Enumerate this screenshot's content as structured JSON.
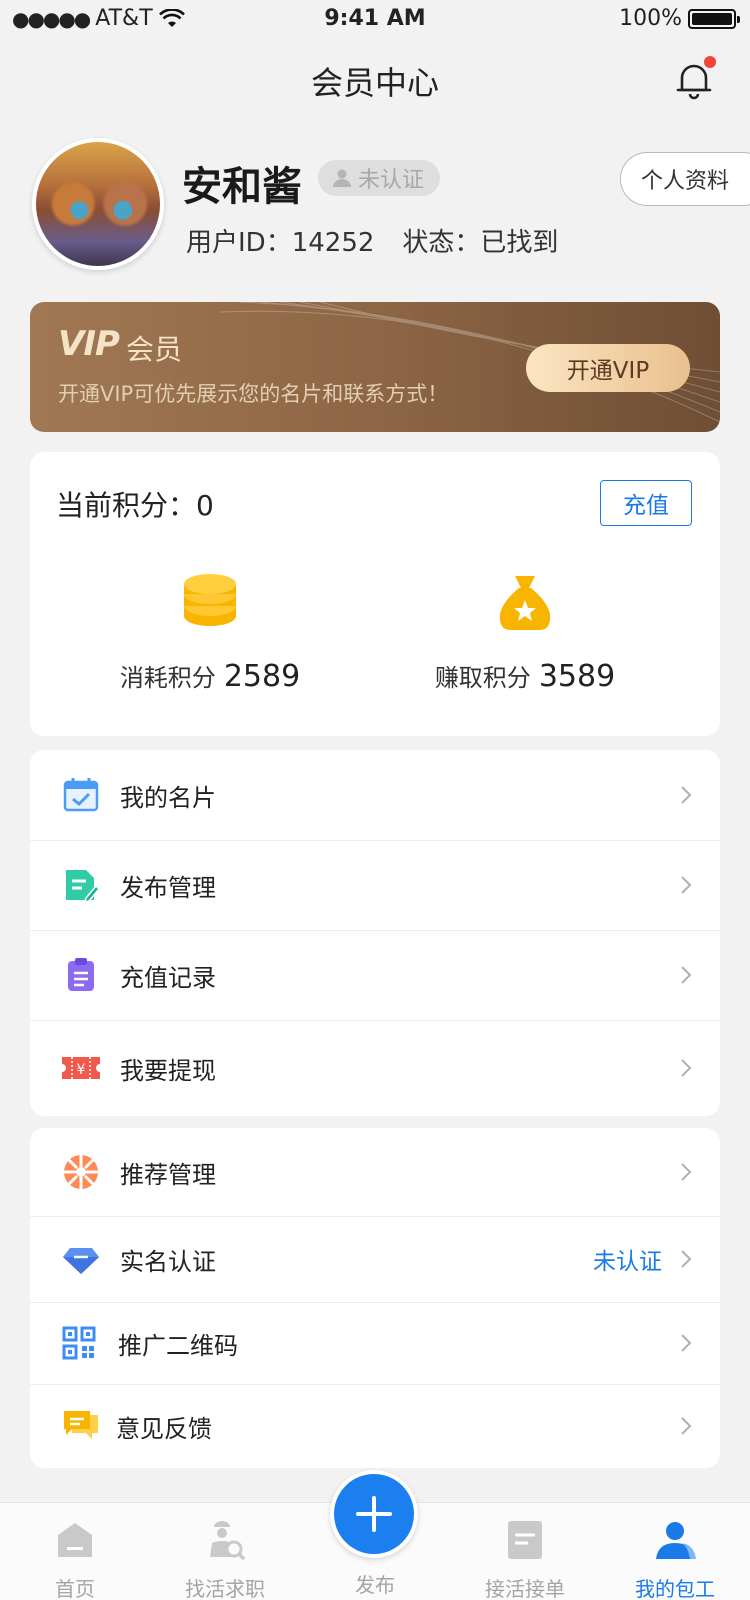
{
  "status_bar": {
    "carrier": "AT&T",
    "time": "9:41 AM",
    "battery": "100%"
  },
  "header": {
    "title": "会员中心"
  },
  "profile": {
    "name": "安和酱",
    "verify_badge": "未认证",
    "profile_button": "个人资料",
    "user_id_text": "用户ID：14252",
    "status_text": "状态：已找到"
  },
  "vip": {
    "logo": "VIP",
    "title": "会员",
    "description": "开通VIP可优先展示您的名片和联系方式！",
    "button": "开通VIP"
  },
  "points": {
    "title": "当前积分：0",
    "recharge_button": "充值",
    "spent_label": "消耗积分",
    "spent_value": "2589",
    "earned_label": "赚取积分",
    "earned_value": "3589"
  },
  "menu_group_1": [
    {
      "label": "我的名片",
      "icon": "business-card-icon"
    },
    {
      "label": "发布管理",
      "icon": "document-edit-icon"
    },
    {
      "label": "充值记录",
      "icon": "clipboard-icon"
    },
    {
      "label": "我要提现",
      "icon": "ticket-yen-icon"
    }
  ],
  "menu_group_2": [
    {
      "label": "推荐管理",
      "icon": "wheel-icon"
    },
    {
      "label": "实名认证",
      "icon": "diamond-icon",
      "status": "未认证"
    },
    {
      "label": "推广二维码",
      "icon": "qr-code-icon"
    },
    {
      "label": "意见反馈",
      "icon": "chat-bubble-icon"
    }
  ],
  "tabbar": [
    {
      "label": "首页",
      "icon": "home-icon"
    },
    {
      "label": "找活求职",
      "icon": "worker-search-icon"
    },
    {
      "label": "发布",
      "icon": "plus-icon"
    },
    {
      "label": "接活接单",
      "icon": "order-doc-icon"
    },
    {
      "label": "我的包工",
      "icon": "person-icon"
    }
  ],
  "colors": {
    "accent": "#1a7ae8",
    "vip_brown": "#8d6645",
    "coin_yellow": "#f7b500"
  }
}
